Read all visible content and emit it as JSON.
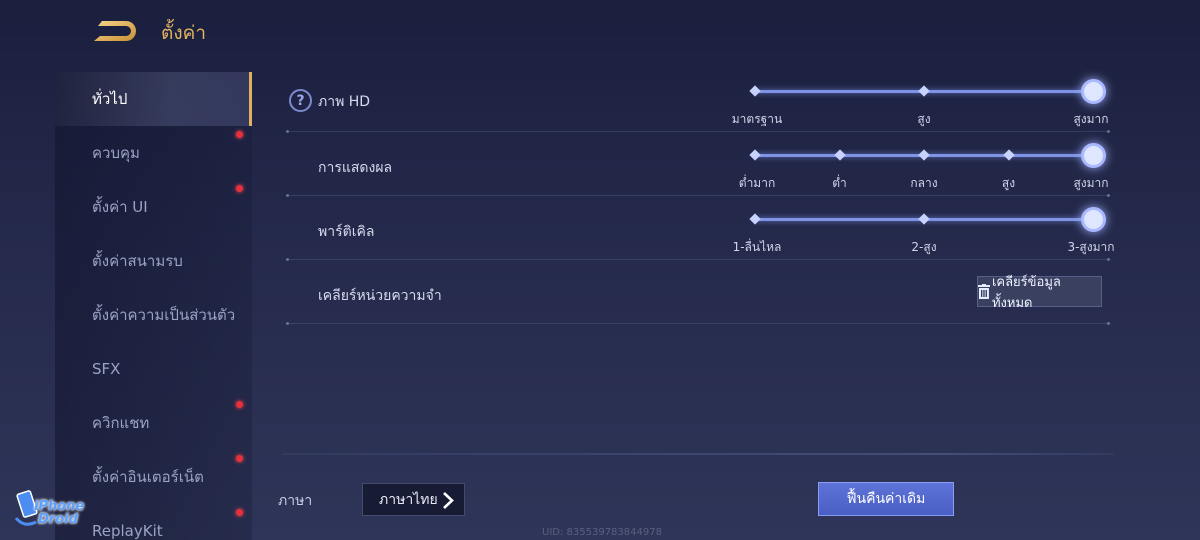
{
  "header": {
    "title": "ตั้งค่า"
  },
  "sidebar": {
    "items": [
      {
        "label": "ทั่วไป",
        "active": true,
        "badge": false
      },
      {
        "label": "ควบคุม",
        "active": false,
        "badge": true
      },
      {
        "label": "ตั้งค่า UI",
        "active": false,
        "badge": true
      },
      {
        "label": "ตั้งค่าสนามรบ",
        "active": false,
        "badge": false
      },
      {
        "label": "ตั้งค่าความเป็นส่วนตัว",
        "active": false,
        "badge": false
      },
      {
        "label": "SFX",
        "active": false,
        "badge": false
      },
      {
        "label": "ควิกแชท",
        "active": false,
        "badge": true
      },
      {
        "label": "ตั้งค่าอินเตอร์เน็ต",
        "active": false,
        "badge": true
      },
      {
        "label": "ReplayKit",
        "active": false,
        "badge": true
      }
    ]
  },
  "settings": {
    "hd": {
      "label": "ภาพ HD",
      "options": [
        "มาตรฐาน",
        "สูง",
        "สูงมาก"
      ],
      "selected_index": 2
    },
    "display": {
      "label": "การแสดงผล",
      "options": [
        "ต่ำมาก",
        "ต่ำ",
        "กลาง",
        "สูง",
        "สูงมาก"
      ],
      "selected_index": 4
    },
    "particle": {
      "label": "พาร์ติเคิล",
      "options": [
        "1-ลื่นไหล",
        "2-สูง",
        "3-สูงมาก"
      ],
      "selected_index": 2
    },
    "cache": {
      "label": "เคลียร์หน่วยความจำ",
      "button_label": "เคลียร์ข้อมูลทั้งหมด"
    }
  },
  "footer": {
    "language_label": "ภาษา",
    "language_value": "ภาษาไทย",
    "restore_label": "ฟื้นคืนค่าเดิม",
    "uid": "UID: 835539783844978"
  },
  "watermark": {
    "line1": "iPhone",
    "line2": "Droid"
  },
  "colors": {
    "accent_gold": "#e2b25e",
    "slider_blue": "#7f94e6",
    "restore_button": "#5366cc",
    "badge_red": "#e8303a"
  }
}
